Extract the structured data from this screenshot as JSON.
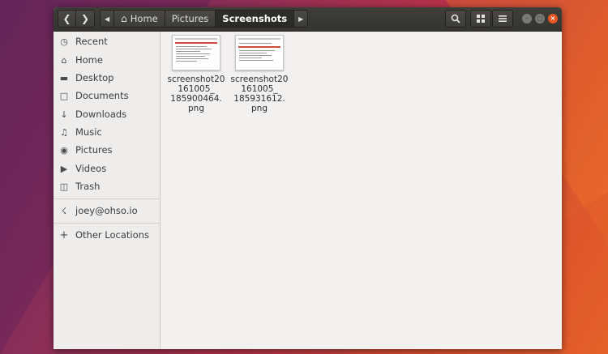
{
  "header": {
    "back_icon": "chevron-left",
    "forward_icon": "chevron-right",
    "path_left_icon": "small-chevron-left",
    "path_right_icon": "small-chevron-right",
    "breadcrumbs": [
      "Home",
      "Pictures",
      "Screenshots"
    ],
    "active_breadcrumb": "Screenshots",
    "tools": [
      "search-icon",
      "view-grid-icon",
      "hamburger-menu-icon"
    ]
  },
  "sidebar": {
    "items": [
      {
        "label": "Recent",
        "icon": "clock-icon"
      },
      {
        "label": "Home",
        "icon": "home-icon"
      },
      {
        "label": "Desktop",
        "icon": "folder-icon"
      },
      {
        "label": "Documents",
        "icon": "document-icon"
      },
      {
        "label": "Downloads",
        "icon": "download-icon"
      },
      {
        "label": "Music",
        "icon": "music-note-icon"
      },
      {
        "label": "Pictures",
        "icon": "camera-icon"
      },
      {
        "label": "Videos",
        "icon": "video-icon"
      },
      {
        "label": "Trash",
        "icon": "trash-icon"
      }
    ],
    "network": [
      {
        "label": "joey@ohso.io",
        "icon": "network-server-icon"
      }
    ],
    "other": [
      {
        "label": "Other Locations",
        "icon": "plus-icon"
      }
    ]
  },
  "files": [
    {
      "name": "screenshot20161005_185900464.png",
      "lines": [
        "screenshot20",
        "161005_",
        "185900464.",
        "png"
      ]
    },
    {
      "name": "screenshot20161005_185931612.png",
      "lines": [
        "screenshot20",
        "161005_",
        "185931612.",
        "png"
      ]
    }
  ],
  "colors": {
    "accent": "#e95420",
    "headerbar": "#3c3b37",
    "sidebar": "#eeedec"
  }
}
